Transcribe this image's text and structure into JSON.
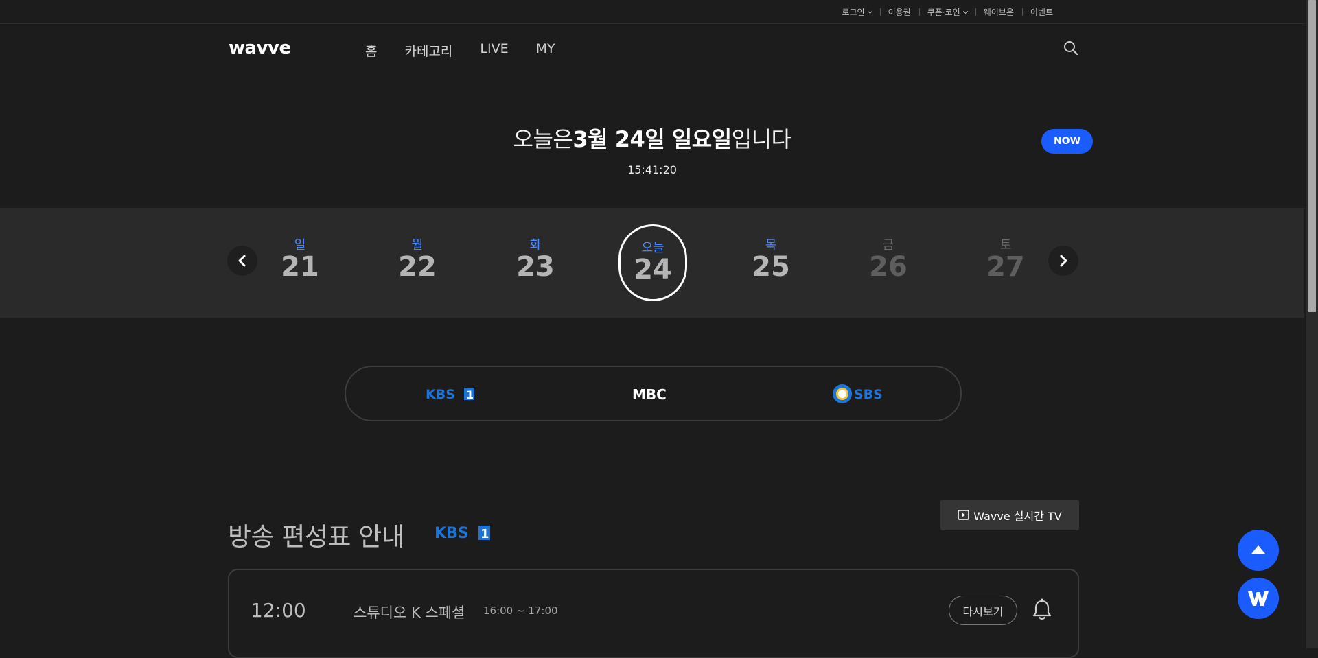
{
  "util_menu": [
    {
      "label": "로그인",
      "has_caret": true
    },
    {
      "label": "이용권",
      "has_caret": false
    },
    {
      "label": "쿠폰·코인",
      "has_caret": true
    },
    {
      "label": "웨이브온",
      "has_caret": false
    },
    {
      "label": "이벤트",
      "has_caret": false
    }
  ],
  "logo": "wavve",
  "nav": [
    "홈",
    "카테고리",
    "LIVE",
    "MY"
  ],
  "icons": {
    "search": "search-icon",
    "bell": "bell-icon",
    "prev": "chevron-left-icon",
    "next": "chevron-right-icon",
    "top": "arrow-up-icon",
    "wavve": "wavve-w-icon",
    "play": "play-icon"
  },
  "today": {
    "prefix": "오늘은",
    "date": "3월 24일 일요일",
    "suffix": "입니다",
    "clock": "15:41:20",
    "now_label": "NOW"
  },
  "days": [
    {
      "dow": "일",
      "num": "21",
      "state": "normal"
    },
    {
      "dow": "월",
      "num": "22",
      "state": "normal"
    },
    {
      "dow": "화",
      "num": "23",
      "state": "normal"
    },
    {
      "dow": "오늘",
      "num": "24",
      "state": "selected"
    },
    {
      "dow": "목",
      "num": "25",
      "state": "normal"
    },
    {
      "dow": "금",
      "num": "26",
      "state": "dim"
    },
    {
      "dow": "토",
      "num": "27",
      "state": "dim"
    }
  ],
  "channels": {
    "kbs": {
      "label": "KBS",
      "badge": "1"
    },
    "mbc": {
      "label": "MBC"
    },
    "sbs": {
      "label": "SBS"
    }
  },
  "schedule": {
    "title": "방송 편성표 안내",
    "live_button": "Wavve 실시간 TV"
  },
  "program": {
    "time": "12:00",
    "title": "스튜디오 K 스페셜",
    "range": "16:00 ~ 17:00",
    "replay_label": "다시보기"
  },
  "colors": {
    "accent": "#1b5cff",
    "background": "#1c1c1c",
    "datebar": "#2a2a2a",
    "kbs_blue": "#1e74d6"
  }
}
